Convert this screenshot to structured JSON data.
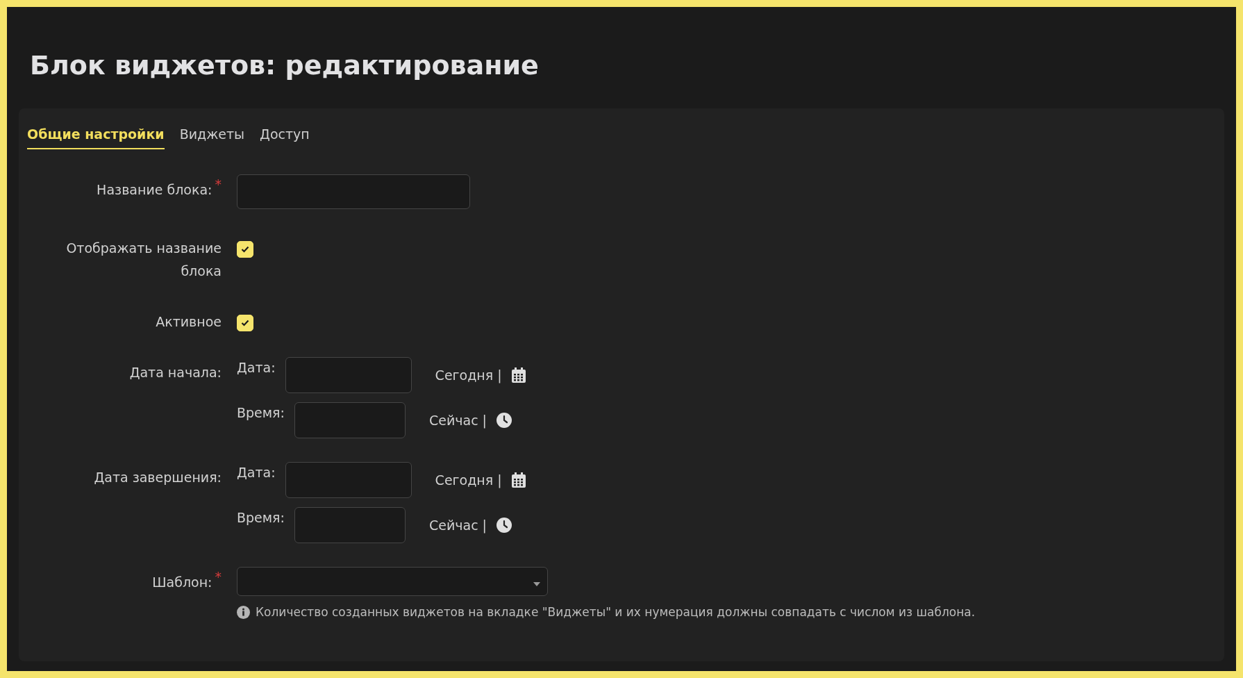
{
  "title": "Блок виджетов: редактирование",
  "tabs": [
    {
      "label": "Общие настройки",
      "selected": true
    },
    {
      "label": "Виджеты",
      "selected": false
    },
    {
      "label": "Доступ",
      "selected": false
    }
  ],
  "fields": [
    {
      "kind": "text",
      "label": "Название блока:",
      "required_mark": "*"
    },
    {
      "kind": "checkbox",
      "label": "Отображать название блока",
      "checked": true
    },
    {
      "kind": "checkbox",
      "label": "Активное",
      "checked": true
    },
    {
      "kind": "datetime",
      "label": "Дата начала:",
      "date_label": "Дата:",
      "date_link": "Сегодня |",
      "time_label": "Время:",
      "time_link": "Сейчас |"
    },
    {
      "kind": "datetime",
      "label": "Дата завершения:",
      "date_label": "Дата:",
      "date_link": "Сегодня |",
      "time_label": "Время:",
      "time_link": "Сейчас |"
    },
    {
      "kind": "select",
      "label": "Шаблон:",
      "required_mark": "*",
      "note": "Количество созданных виджетов на вкладке \"Виджеты\" и их нумерация должны совпадать с числом из шаблона."
    }
  ]
}
